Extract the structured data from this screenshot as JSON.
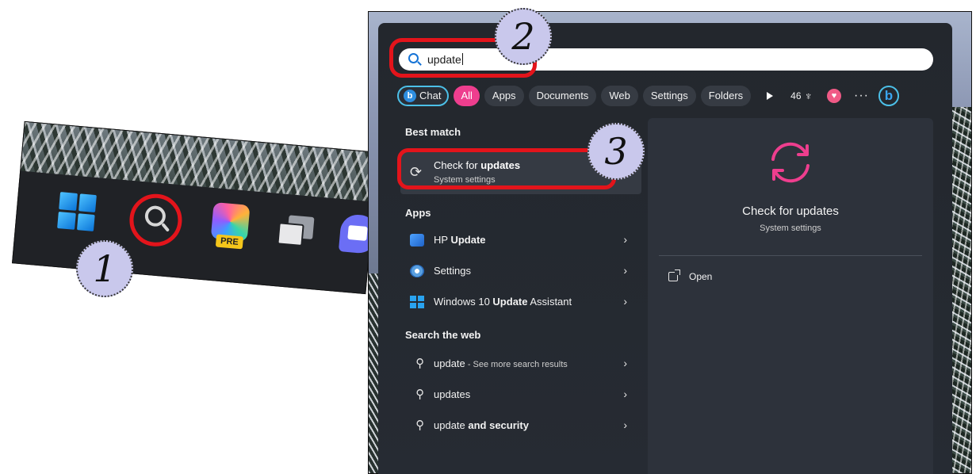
{
  "markers": {
    "one": "1",
    "two": "2",
    "three": "3"
  },
  "taskbar": {
    "copilot_badge": "PRE"
  },
  "search": {
    "query": "update"
  },
  "filters": {
    "chat": "Chat",
    "items": [
      "All",
      "Apps",
      "Documents",
      "Web",
      "Settings",
      "Folders"
    ],
    "reward_count": "46",
    "more": "···"
  },
  "best_match": {
    "heading": "Best match",
    "title_prefix": "Check for ",
    "title_bold": "updates",
    "subtitle": "System settings"
  },
  "apps": {
    "heading": "Apps",
    "items": [
      {
        "prefix": "HP ",
        "bold": "Update",
        "suffix": ""
      },
      {
        "prefix": "Settings",
        "bold": "",
        "suffix": ""
      },
      {
        "prefix": "Windows 10 ",
        "bold": "Update",
        "suffix": " Assistant"
      }
    ]
  },
  "web": {
    "heading": "Search the web",
    "items": [
      {
        "text": "update",
        "bold": "",
        "sub": " - See more search results"
      },
      {
        "text": "updates",
        "bold": "",
        "sub": ""
      },
      {
        "text": "update ",
        "bold": "and security",
        "sub": ""
      }
    ]
  },
  "preview": {
    "title": "Check for updates",
    "subtitle": "System settings",
    "open_label": "Open"
  },
  "colors": {
    "accent_pink": "#ee3e8e",
    "highlight_red": "#e3141b",
    "flyout_bg": "#23272d"
  }
}
